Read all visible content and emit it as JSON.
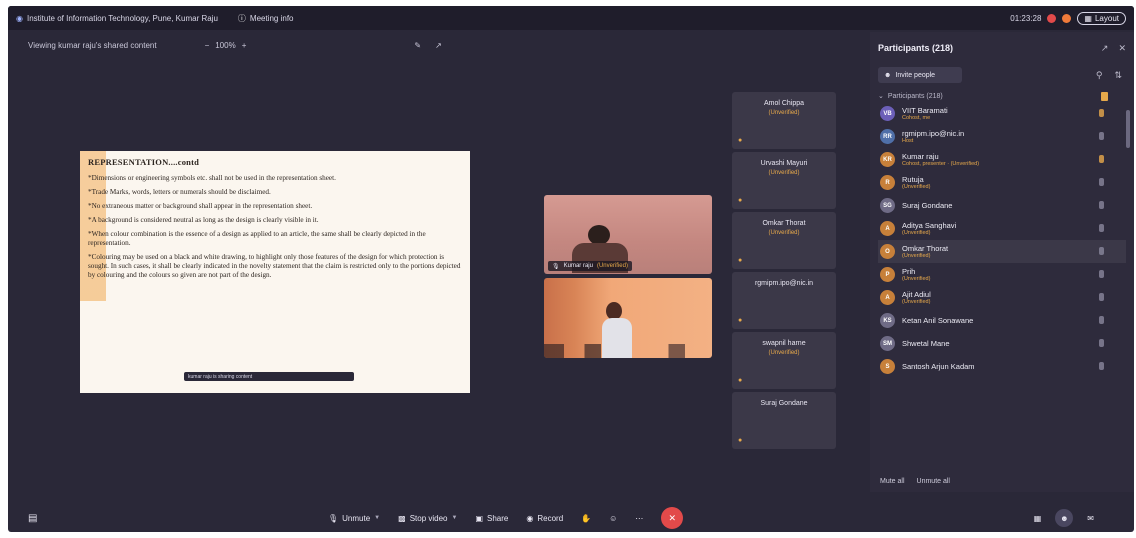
{
  "titlebar": {
    "org_name": "Institute of Information Technology, Pune, Kumar Raju",
    "meeting_info": "Meeting info",
    "time": "01:23:28",
    "layout_label": "Layout"
  },
  "sharebar": {
    "viewing": "Viewing kumar raju's shared content",
    "zoom": "100%"
  },
  "doc": {
    "heading": "REPRESENTATION....contd",
    "points": [
      "*Dimensions or engineering symbols etc. shall not be used in the representation sheet.",
      "*Trade Marks, words, letters or numerals should be disclaimed.",
      "*No extraneous matter or background shall appear in the representation sheet.",
      "*A background is considered neutral as long as the design is clearly visible in it.",
      "*When colour combination is the essence of a design as applied to an article, the same shall be clearly depicted in the representation.",
      "*Colouring may be used on a black and white drawing, to highlight only those features of the design for which protection is sought. In such cases, it shall be clearly indicated in the novelty statement that the claim is restricted only to the portions depicted by colouring and the colours so given are not part of the design."
    ],
    "tooltip_text": "kumar raju is sharing content"
  },
  "videos": {
    "kumar_label": "Kumar raju",
    "kumar_status": "(Unverified)"
  },
  "grid_tiles": [
    {
      "name": "Amol Chippa",
      "status": "(Unverified)"
    },
    {
      "name": "Urvashi Mayuri",
      "status": "(Unverified)"
    },
    {
      "name": "Omkar Thorat",
      "status": "(Unverified)"
    },
    {
      "name": "rgmipm.ipo@nic.in",
      "status": ""
    },
    {
      "name": "swapnil harne",
      "status": "(Unverified)"
    },
    {
      "name": "Suraj Gondane",
      "status": ""
    }
  ],
  "panel": {
    "title": "Participants (218)",
    "invite": "Invite people",
    "section": "Participants (218)",
    "mute_all": "Mute all",
    "unmute_all": "Unmute all",
    "participants": [
      {
        "initials": "VB",
        "name": "VIIT Baramati",
        "sub": "Cohost, me",
        "color": "#6c5fb8"
      },
      {
        "initials": "RR",
        "name": "rgmipm.ipo@nic.in",
        "sub": "Host",
        "color": "#4f6fa8"
      },
      {
        "initials": "KR",
        "name": "Kumar raju",
        "sub": "Cohost, presenter · (Unverified)",
        "color": "#c7803a"
      },
      {
        "initials": "R",
        "name": "Rutuja",
        "sub": "(Unverified)",
        "color": "#c7803a"
      },
      {
        "initials": "SG",
        "name": "Suraj Gondane",
        "sub": "",
        "color": "#6f6b86"
      },
      {
        "initials": "A",
        "name": "Aditya Sanghavi",
        "sub": "(Unverified)",
        "color": "#c7803a"
      },
      {
        "initials": "O",
        "name": "Omkar Thorat",
        "sub": "(Unverified)",
        "color": "#c7803a"
      },
      {
        "initials": "P",
        "name": "Prih",
        "sub": "(Unverified)",
        "color": "#c7803a"
      },
      {
        "initials": "A",
        "name": "Ajit Adiul",
        "sub": "(Unverified)",
        "color": "#c7803a"
      },
      {
        "initials": "KS",
        "name": "Ketan Anil Sonawane",
        "sub": "",
        "color": "#6f6b86"
      },
      {
        "initials": "SM",
        "name": "Shwetal Mane",
        "sub": "",
        "color": "#6f6b86"
      },
      {
        "initials": "S",
        "name": "Santosh Arjun Kadam",
        "sub": "",
        "color": "#c7803a"
      }
    ]
  },
  "toolbar": {
    "unmute": "Unmute",
    "stop_video": "Stop video",
    "share": "Share",
    "record": "Record"
  },
  "colors": {
    "accent": "#e7a94b",
    "end_call": "#e24a4a",
    "background": "#2a2838"
  }
}
